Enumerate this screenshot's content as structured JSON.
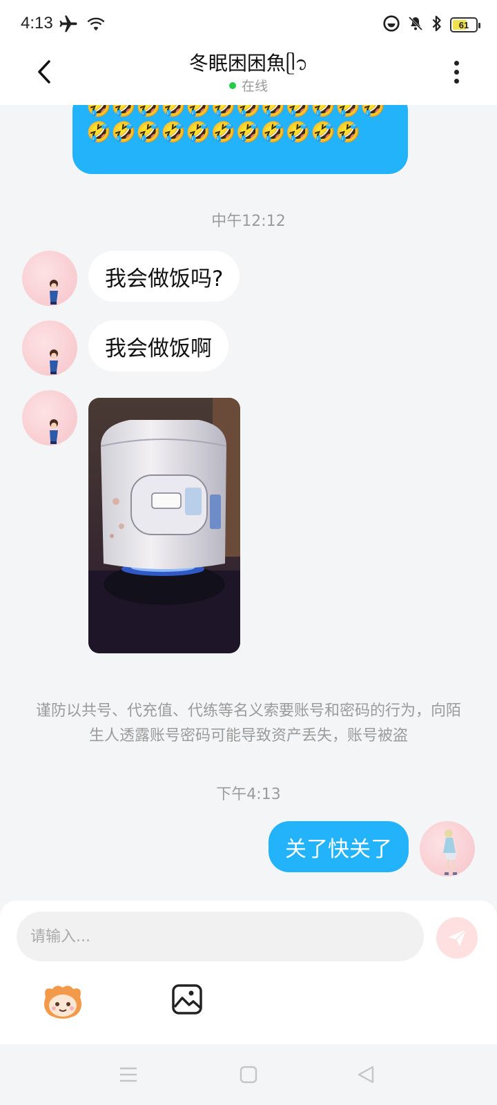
{
  "status_bar": {
    "time": "4:13",
    "battery": "61",
    "battery_level": 0.61,
    "icons": [
      "airplane-icon",
      "wifi-icon",
      "focus-mode-icon",
      "mute-icon",
      "bluetooth-icon",
      "battery-icon"
    ]
  },
  "header": {
    "title": "冬眠困困魚ᥫ᭡",
    "status": "在线",
    "online_color": "#27c94a"
  },
  "chat": {
    "top_bubble_emojis": "🤣🤣🤣🤣🤣🤣🤣🤣🤣🤣🤣🤣🤣🤣🤣🤣🤣🤣🤣🤣🤣🤣🤣",
    "timestamp_1": "中午12:12",
    "messages": [
      {
        "text": "我会做饭吗?",
        "side": "left"
      },
      {
        "text": "我会做饭啊",
        "side": "left"
      }
    ],
    "photo": {
      "type": "image",
      "subject": "rice-cooker-on-gas-stove"
    },
    "warning": "谨防以共号、代充值、代练等名义索要账号和密码的行为，向陌生人透露账号密码可能导致资产丢失，账号被盗",
    "timestamp_2": "下午4:13",
    "my_message": "关了快关了",
    "bubble_color": "#23b3fa"
  },
  "input": {
    "placeholder": "请输入...",
    "value": ""
  },
  "toolbar": {
    "icons": [
      "emoji-mascot-icon",
      "image-icon"
    ]
  },
  "nav": {
    "icons": [
      "menu-icon",
      "home-icon",
      "back-icon"
    ]
  }
}
